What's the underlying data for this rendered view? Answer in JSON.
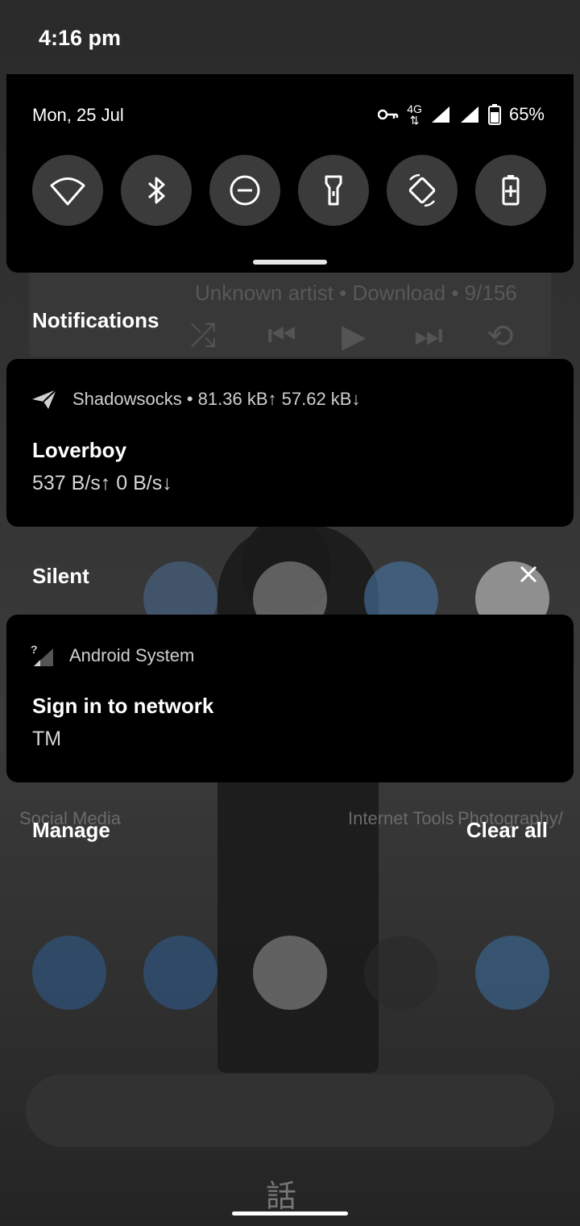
{
  "status_bar": {
    "time": "4:16 pm"
  },
  "quick_settings": {
    "date": "Mon, 25 Jul",
    "network_type": "4G",
    "battery": "65%",
    "tiles": [
      {
        "name": "wifi-icon"
      },
      {
        "name": "bluetooth-icon"
      },
      {
        "name": "do-not-disturb-icon"
      },
      {
        "name": "flashlight-icon"
      },
      {
        "name": "auto-rotate-icon"
      },
      {
        "name": "battery-saver-icon"
      }
    ]
  },
  "background_media": {
    "subtitle": "Unknown artist • Download • 9/156"
  },
  "notifications": {
    "section_label": "Notifications",
    "items": [
      {
        "app": "Shadowsocks",
        "meta": " • 81.36 kB↑  57.62 kB↓",
        "title": "Loverboy",
        "text": "537 B/s↑ 0 B/s↓",
        "icon": "paper-plane-icon"
      }
    ]
  },
  "silent": {
    "section_label": "Silent",
    "items": [
      {
        "app": "Android System",
        "title": "Sign in to network",
        "text": "TM",
        "icon": "signal-question-icon"
      }
    ]
  },
  "background_labels": {
    "folder1": "Social Media",
    "folder2": "Internet Tools",
    "folder3": "Photography/"
  },
  "footer": {
    "manage": "Manage",
    "clear_all": "Clear all"
  },
  "colors": {
    "panel": "#000000",
    "tile": "#3b3b3b",
    "text": "#ffffff"
  }
}
